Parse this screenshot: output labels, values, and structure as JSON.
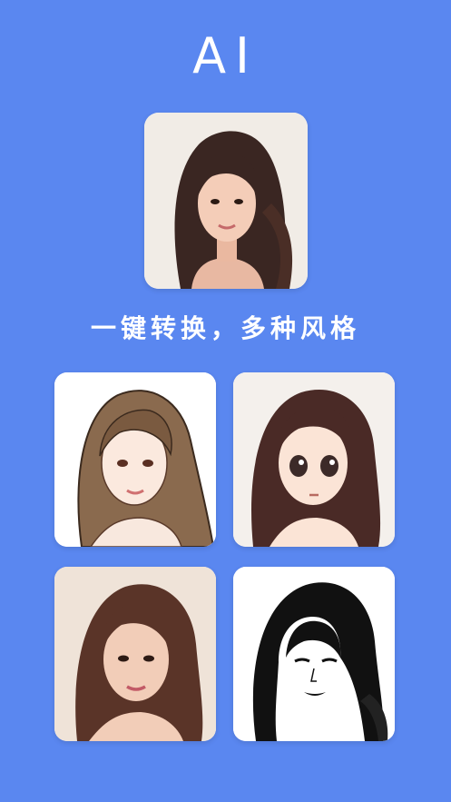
{
  "header": {
    "title": "AI"
  },
  "tagline": "一键转换，多种风格",
  "colors": {
    "background": "#5a87f0",
    "text": "#ffffff"
  },
  "images": {
    "original": "portrait-photo",
    "styles": [
      "sketch-color-style",
      "anime-style",
      "painted-cartoon-style",
      "black-white-ink-style"
    ]
  }
}
